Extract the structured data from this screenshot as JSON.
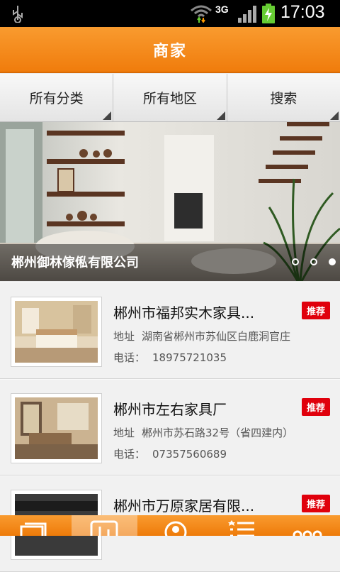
{
  "status_bar": {
    "network": "3G",
    "time": "17:03"
  },
  "header": {
    "title": "商家"
  },
  "filters": [
    {
      "label": "所有分类"
    },
    {
      "label": "所有地区"
    },
    {
      "label": "搜索"
    }
  ],
  "banner": {
    "caption": "郴州御林傢俬有限公司",
    "slide_count": 3,
    "active_slide": 3
  },
  "merchants": [
    {
      "name": "郴州市福邦实木家具...",
      "badge": "推荐",
      "address_label": "地址",
      "address": "湖南省郴州市苏仙区白鹿洞官庄",
      "phone_label": "电话：",
      "phone": "18975721035"
    },
    {
      "name": "郴州市左右家具厂",
      "badge": "推荐",
      "address_label": "地址",
      "address": "郴州市苏石路32号（省四建内）",
      "phone_label": "电话：",
      "phone": "07357560689"
    },
    {
      "name": "郴州市万原家居有限...",
      "badge": "推荐",
      "address_label": "",
      "address": "",
      "phone_label": "",
      "phone": ""
    }
  ],
  "bottom_nav": {
    "active_index": 1,
    "icons": [
      "cards-icon",
      "chart-icon",
      "person-icon",
      "list-icon",
      "more-icon"
    ]
  },
  "colors": {
    "accent": "#f28a1c",
    "badge": "#e0000c"
  }
}
